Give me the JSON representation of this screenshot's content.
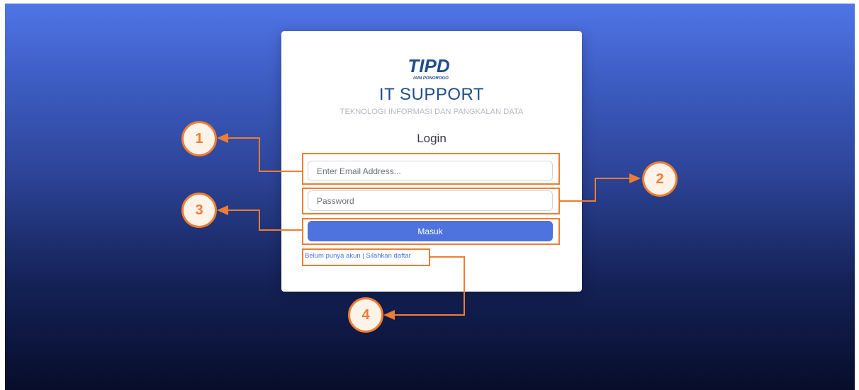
{
  "brand": {
    "logo_text": "TIPD",
    "logo_subtext": "IAIN PONOROGO",
    "title": "IT SUPPORT",
    "tagline": "TEKNOLOGI INFORMASI DAN PANGKALAN DATA"
  },
  "form": {
    "heading": "Login",
    "email_placeholder": "Enter Email Address...",
    "password_placeholder": "Password",
    "submit_label": "Masuk",
    "register_link": "Belum punya akun | Silahkan daftar"
  },
  "annotations": [
    {
      "number": "1",
      "target": "email-field"
    },
    {
      "number": "2",
      "target": "password-field"
    },
    {
      "number": "3",
      "target": "login-button"
    },
    {
      "number": "4",
      "target": "register-link"
    }
  ],
  "colors": {
    "accent": "#4e73df",
    "callout": "#ef7d31",
    "brand_text": "#1f4e8c",
    "background_top": "#4f75e6",
    "background_bottom": "#070d2a"
  }
}
